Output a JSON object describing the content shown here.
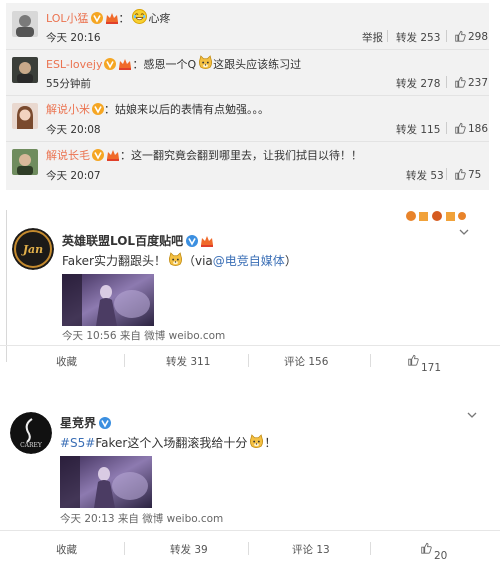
{
  "comments": [
    {
      "name": "LOL小猛",
      "sep": "：",
      "text": "心疼",
      "time": "今天 20:16",
      "report": "举报",
      "repost": "转发 253",
      "likes": "298"
    },
    {
      "name": "ESL-lovejy",
      "sep": "：",
      "text": "感恩一个Q",
      "text2": "这跟头应该练习过",
      "time": "55分钟前",
      "repost": "转发 278",
      "likes": "237"
    },
    {
      "name": "解说小米",
      "sep": "：",
      "text": "姑娘来以后的表情有点勉强。。。",
      "time": "今天 20:08",
      "repost": "转发 115",
      "likes": "186"
    },
    {
      "name": "解说长毛",
      "sep": "：",
      "text": "这一翻究竟会翻到哪里去，让我们拭目以待！！",
      "time": "今天 20:07",
      "repost": "转发 53",
      "likes": "75"
    }
  ],
  "post1": {
    "name": "英雄联盟LOL百度贴吧",
    "text_a": "Faker实力翻跟头！",
    "text_b": "（via",
    "link": "@电竞自媒体",
    "text_c": "）",
    "meta": "今天 10:56 来自 微博 weibo.com",
    "fav": "收藏",
    "repost": "转发 311",
    "comment": "评论 156",
    "likes": "171"
  },
  "post2": {
    "name": "星竞界",
    "tag": "#S5#",
    "text": "Faker这个入场翻滚我给十分",
    "text_end": "！",
    "meta": "今天 20:13 来自 微博 weibo.com",
    "fav": "收藏",
    "repost": "转发 39",
    "comment": "评论 13",
    "likes": "20"
  },
  "colors": {
    "name_orange": "#eb7350",
    "link_blue": "#3b6fb6",
    "vip_gold": "#f5a623",
    "panel_bg": "#f2f2f2"
  }
}
